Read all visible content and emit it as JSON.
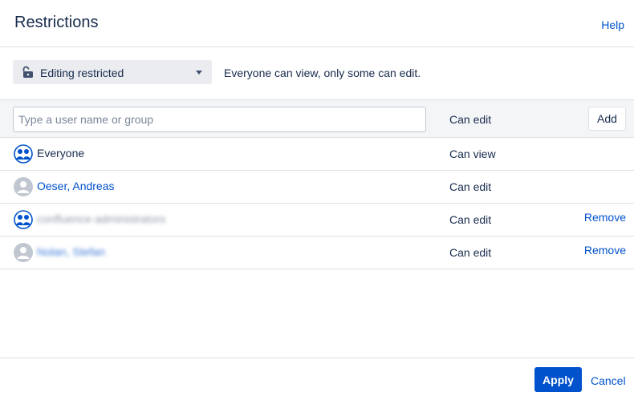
{
  "header": {
    "title": "Restrictions",
    "help_label": "Help"
  },
  "mode": {
    "selected": "Editing restricted",
    "description": "Everyone can view, only some can edit.",
    "lock_icon": "unlock-icon"
  },
  "add_user": {
    "placeholder": "Type a user name or group",
    "value": "",
    "permission": "Can edit",
    "add_label": "Add"
  },
  "entries": [
    {
      "name": "Everyone",
      "type": "group",
      "permission": "Can view",
      "remove_label": ""
    },
    {
      "name": "Oeser, Andreas",
      "type": "user",
      "permission": "Can edit",
      "remove_label": ""
    },
    {
      "name": "confluence-administrators",
      "type": "group",
      "permission": "Can edit",
      "remove_label": "Remove"
    },
    {
      "name": "Nolan, Stefan",
      "type": "user",
      "permission": "Can edit",
      "remove_label": "Remove"
    }
  ],
  "footer": {
    "apply_label": "Apply",
    "cancel_label": "Cancel"
  },
  "colors": {
    "primary": "#0052cc",
    "text": "#172b4d",
    "border": "#dfe1e6",
    "subtle_bg": "#f4f5f7"
  }
}
